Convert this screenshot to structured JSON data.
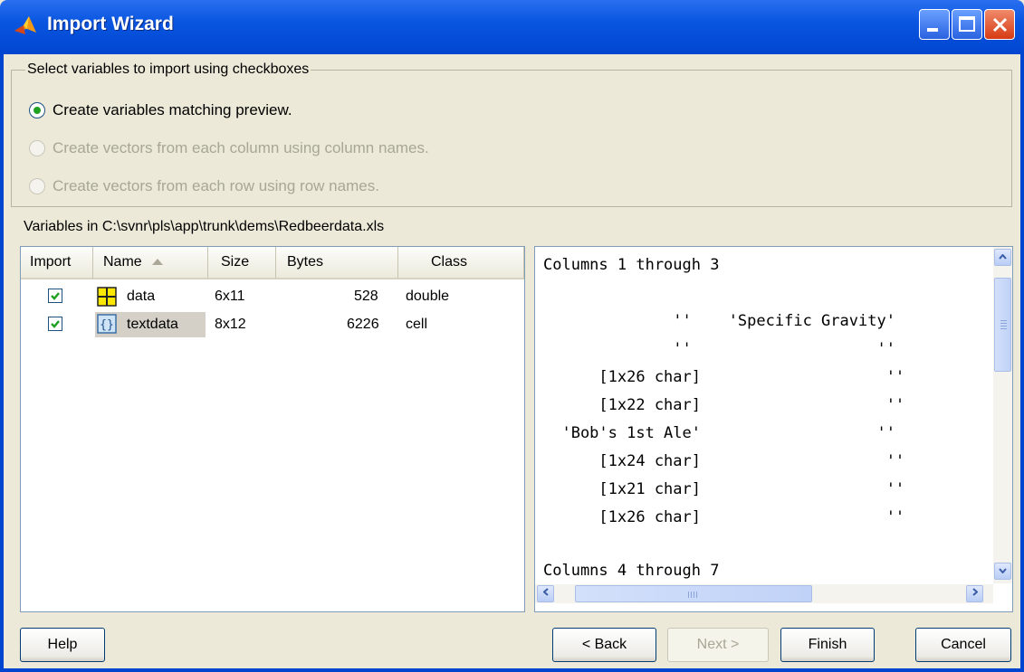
{
  "window": {
    "title": "Import Wizard",
    "controls": [
      "minimize-icon",
      "maximize-icon",
      "close-icon"
    ]
  },
  "options": {
    "group_label": "Select variables to import using checkboxes",
    "items": [
      {
        "label": "Create variables matching preview.",
        "selected": true,
        "enabled": true
      },
      {
        "label": "Create vectors from each column using column names.",
        "selected": false,
        "enabled": false
      },
      {
        "label": "Create vectors from each row using row names.",
        "selected": false,
        "enabled": false
      }
    ]
  },
  "variables": {
    "path_label": "Variables in C:\\svnr\\pls\\app\\trunk\\dems\\Redbeerdata.xls",
    "columns": [
      "Import",
      "Name",
      "Size",
      "Bytes",
      "Class"
    ],
    "sort_icon": "sort-ascending-icon",
    "rows": [
      {
        "checked": true,
        "icon": "matrix-icon",
        "name": "data",
        "size": "6x11",
        "bytes": "528",
        "class": "double"
      },
      {
        "checked": true,
        "icon": "cell-array-icon",
        "name": "textdata",
        "size": "8x12",
        "bytes": "6226",
        "class": "cell"
      }
    ]
  },
  "preview": {
    "lines": [
      "Columns 1 through 3",
      "",
      "              ''    'Specific Gravity'",
      "              ''                    ''",
      "      [1x26 char]                    ''",
      "      [1x22 char]                    ''",
      "  'Bob's 1st Ale'                   ''",
      "      [1x24 char]                    ''",
      "      [1x21 char]                    ''",
      "      [1x26 char]                    ''",
      "",
      "Columns 4 through 7"
    ]
  },
  "buttons": {
    "help": "Help",
    "back": "< Back",
    "next": "Next >",
    "finish": "Finish",
    "cancel": "Cancel"
  },
  "colors": {
    "titlebar": "#0045d0",
    "dialog_bg": "#ece9d8",
    "radio_selected": "#21a121",
    "checkbox_check": "#21a121",
    "disabled_text": "#a8a695"
  }
}
